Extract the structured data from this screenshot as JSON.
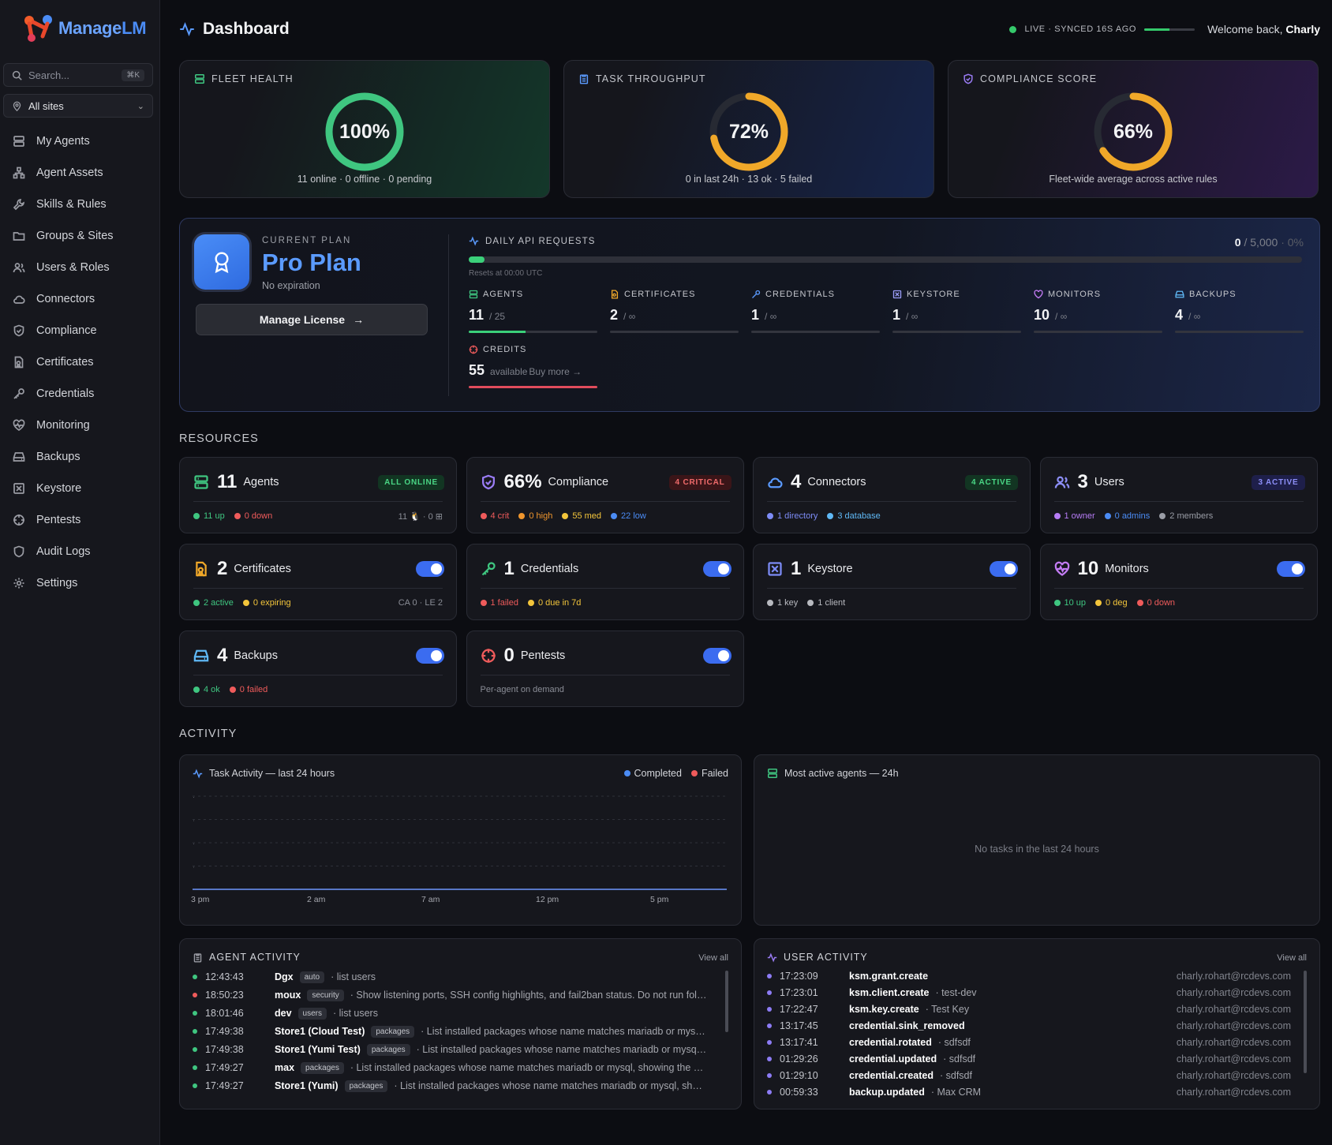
{
  "brand": {
    "name_a": "Manage",
    "name_b": "LM"
  },
  "search": {
    "placeholder": "Search...",
    "shortcut": "⌘K"
  },
  "site_filter": "All sites",
  "nav": [
    "My Agents",
    "Agent Assets",
    "Skills & Rules",
    "Groups & Sites",
    "Users & Roles",
    "Connectors",
    "Compliance",
    "Certificates",
    "Credentials",
    "Monitoring",
    "Backups",
    "Keystore",
    "Pentests",
    "Audit Logs",
    "Settings"
  ],
  "header": {
    "title": "Dashboard",
    "live": "LIVE · SYNCED 16S AGO",
    "live_progress": 0.5,
    "welcome": "Welcome back,",
    "user": "Charly"
  },
  "stats": [
    {
      "label": "FLEET HEALTH",
      "value": "100%",
      "pct": 1.0,
      "color": "#3fc680",
      "sub": "11 online · 0 offline · 0 pending",
      "bg": "#14382a"
    },
    {
      "label": "TASK THROUGHPUT",
      "value": "72%",
      "pct": 0.72,
      "color": "#f0a829",
      "sub": "0 in last 24h · 13 ok · 5 failed",
      "bg": "#16244a"
    },
    {
      "label": "COMPLIANCE SCORE",
      "value": "66%",
      "pct": 0.66,
      "color": "#f0a829",
      "sub": "Fleet-wide average across active rules",
      "bg": "#2c1a48"
    }
  ],
  "plan": {
    "current": "CURRENT PLAN",
    "name": "Pro Plan",
    "expiry": "No expiration",
    "button": "Manage License",
    "api_label": "DAILY API REQUESTS",
    "api_used": "0",
    "api_total": "/ 5,000",
    "api_pct": "· 0%",
    "api_reset": "Resets at 00:00 UTC",
    "quotas": [
      {
        "label": "AGENTS",
        "value": "11",
        "limit": "/ 25",
        "fill": 0.44,
        "color": "#3bd07a"
      },
      {
        "label": "CERTIFICATES",
        "value": "2",
        "limit": "/ ∞",
        "fill": 0,
        "color": "#3bd07a"
      },
      {
        "label": "CREDENTIALS",
        "value": "1",
        "limit": "/ ∞",
        "fill": 0,
        "color": "#3bd07a"
      },
      {
        "label": "KEYSTORE",
        "value": "1",
        "limit": "/ ∞",
        "fill": 0,
        "color": "#3bd07a"
      },
      {
        "label": "MONITORS",
        "value": "10",
        "limit": "/ ∞",
        "fill": 0,
        "color": "#3bd07a"
      },
      {
        "label": "BACKUPS",
        "value": "4",
        "limit": "/ ∞",
        "fill": 0,
        "color": "#3bd07a"
      }
    ],
    "credits": {
      "label": "CREDITS",
      "value": "55",
      "unit": "available",
      "buy": "Buy more →",
      "fill": 1,
      "color": "#e04c5c"
    }
  },
  "sections": {
    "resources": "RESOURCES",
    "activity": "ACTIVITY"
  },
  "resources": [
    {
      "num": "11",
      "name": "Agents",
      "badge": "ALL ONLINE",
      "badge_fg": "#4ad685",
      "badge_bg": "#123522",
      "items": [
        {
          "t": "11 up",
          "c": "#3fc680"
        },
        {
          "t": "0 down",
          "c": "#ef5b5b"
        }
      ],
      "right": "11 🐧 · 0 ⊞"
    },
    {
      "num": "66%",
      "name": "Compliance",
      "badge": "4 CRITICAL",
      "badge_fg": "#f06b6b",
      "badge_bg": "#3a1518",
      "items": [
        {
          "t": "4 crit",
          "c": "#ef5b5b"
        },
        {
          "t": "0 high",
          "c": "#f0962d"
        },
        {
          "t": "55 med",
          "c": "#f3c53b"
        },
        {
          "t": "22 low",
          "c": "#4b8cf5"
        }
      ],
      "right": ""
    },
    {
      "num": "4",
      "name": "Connectors",
      "badge": "4 ACTIVE",
      "badge_fg": "#4ad685",
      "badge_bg": "#123522",
      "items": [
        {
          "t": "1 directory",
          "c": "#7d8cf7"
        },
        {
          "t": "3 database",
          "c": "#5fb8f5"
        }
      ],
      "right": ""
    },
    {
      "num": "3",
      "name": "Users",
      "badge": "3 ACTIVE",
      "badge_fg": "#8d8ff7",
      "badge_bg": "#1e1f4a",
      "items": [
        {
          "t": "1 owner",
          "c": "#b67cf5"
        },
        {
          "t": "0 admins",
          "c": "#4b8cf5"
        },
        {
          "t": "2 members",
          "c": "#9a9da6"
        }
      ],
      "right": ""
    },
    {
      "num": "2",
      "name": "Certificates",
      "badge": "",
      "items": [
        {
          "t": "2 active",
          "c": "#3fc680"
        },
        {
          "t": "0 expiring",
          "c": "#f3c53b"
        }
      ],
      "right": "CA 0 · LE 2"
    },
    {
      "num": "1",
      "name": "Credentials",
      "badge": "",
      "items": [
        {
          "t": "1 failed",
          "c": "#ef5b5b"
        },
        {
          "t": "0 due in 7d",
          "c": "#f3c53b"
        }
      ],
      "right": ""
    },
    {
      "num": "1",
      "name": "Keystore",
      "badge": "",
      "items": [
        {
          "t": "1 key",
          "c": "#b8bac0"
        },
        {
          "t": "1 client",
          "c": "#b8bac0"
        }
      ],
      "right": ""
    },
    {
      "num": "10",
      "name": "Monitors",
      "badge": "",
      "items": [
        {
          "t": "10 up",
          "c": "#3fc680"
        },
        {
          "t": "0 deg",
          "c": "#f3c53b"
        },
        {
          "t": "0 down",
          "c": "#ef5b5b"
        }
      ],
      "right": ""
    },
    {
      "num": "4",
      "name": "Backups",
      "badge": "",
      "items": [
        {
          "t": "4 ok",
          "c": "#3fc680"
        },
        {
          "t": "0 failed",
          "c": "#ef5b5b"
        }
      ],
      "right": ""
    },
    {
      "num": "0",
      "name": "Pentests",
      "badge": "",
      "items": [],
      "note": "Per-agent on demand",
      "right": ""
    }
  ],
  "chart_data": {
    "type": "line",
    "title": "Task Activity — last 24 hours",
    "xticks": [
      "3 pm",
      "2 am",
      "7 am",
      "12 pm",
      "5 pm"
    ],
    "series": [
      {
        "name": "Completed",
        "color": "#4b8cf5",
        "values": [
          0,
          0,
          0,
          0,
          0
        ]
      },
      {
        "name": "Failed",
        "color": "#ef5b5b",
        "values": [
          0,
          0,
          0,
          0,
          0
        ]
      }
    ]
  },
  "top_agents": {
    "title": "Most active agents — 24h",
    "empty": "No tasks in the last 24 hours"
  },
  "agent_activity": {
    "title": "AGENT ACTIVITY",
    "view_all": "View all",
    "rows": [
      {
        "time": "12:43:43",
        "name": "Dgx",
        "tag": "auto",
        "desc": "· list users",
        "c": "#3fc680"
      },
      {
        "time": "18:50:23",
        "name": "moux",
        "tag": "security",
        "desc": "· Show listening ports, SSH config highlights, and fail2ban status. Do not run follo...",
        "c": "#ef5b5b"
      },
      {
        "time": "18:01:46",
        "name": "dev",
        "tag": "users",
        "desc": "· list users",
        "c": "#3fc680"
      },
      {
        "time": "17:49:38",
        "name": "Store1 (Cloud Test)",
        "tag": "packages",
        "desc": "· List installed packages whose name matches mariadb or mysql, ...",
        "c": "#3fc680"
      },
      {
        "time": "17:49:38",
        "name": "Store1 (Yumi Test)",
        "tag": "packages",
        "desc": "· List installed packages whose name matches mariadb or mysql, s...",
        "c": "#3fc680"
      },
      {
        "time": "17:49:27",
        "name": "max",
        "tag": "packages",
        "desc": "· List installed packages whose name matches mariadb or mysql, showing the ex...",
        "c": "#3fc680"
      },
      {
        "time": "17:49:27",
        "name": "Store1 (Yumi)",
        "tag": "packages",
        "desc": "· List installed packages whose name matches mariadb or mysql, showi...",
        "c": "#3fc680"
      }
    ]
  },
  "user_activity": {
    "title": "USER ACTIVITY",
    "view_all": "View all",
    "rows": [
      {
        "time": "17:23:09",
        "name": "ksm.grant.create",
        "desc": "",
        "email": "charly.rohart@rcdevs.com"
      },
      {
        "time": "17:23:01",
        "name": "ksm.client.create",
        "desc": "· test-dev",
        "email": "charly.rohart@rcdevs.com"
      },
      {
        "time": "17:22:47",
        "name": "ksm.key.create",
        "desc": "· Test Key",
        "email": "charly.rohart@rcdevs.com"
      },
      {
        "time": "13:17:45",
        "name": "credential.sink_removed",
        "desc": "",
        "email": "charly.rohart@rcdevs.com"
      },
      {
        "time": "13:17:41",
        "name": "credential.rotated",
        "desc": "· sdfsdf",
        "email": "charly.rohart@rcdevs.com"
      },
      {
        "time": "01:29:26",
        "name": "credential.updated",
        "desc": "· sdfsdf",
        "email": "charly.rohart@rcdevs.com"
      },
      {
        "time": "01:29:10",
        "name": "credential.created",
        "desc": "· sdfsdf",
        "email": "charly.rohart@rcdevs.com"
      },
      {
        "time": "00:59:33",
        "name": "backup.updated",
        "desc": "· Max CRM",
        "email": "charly.rohart@rcdevs.com"
      }
    ]
  }
}
